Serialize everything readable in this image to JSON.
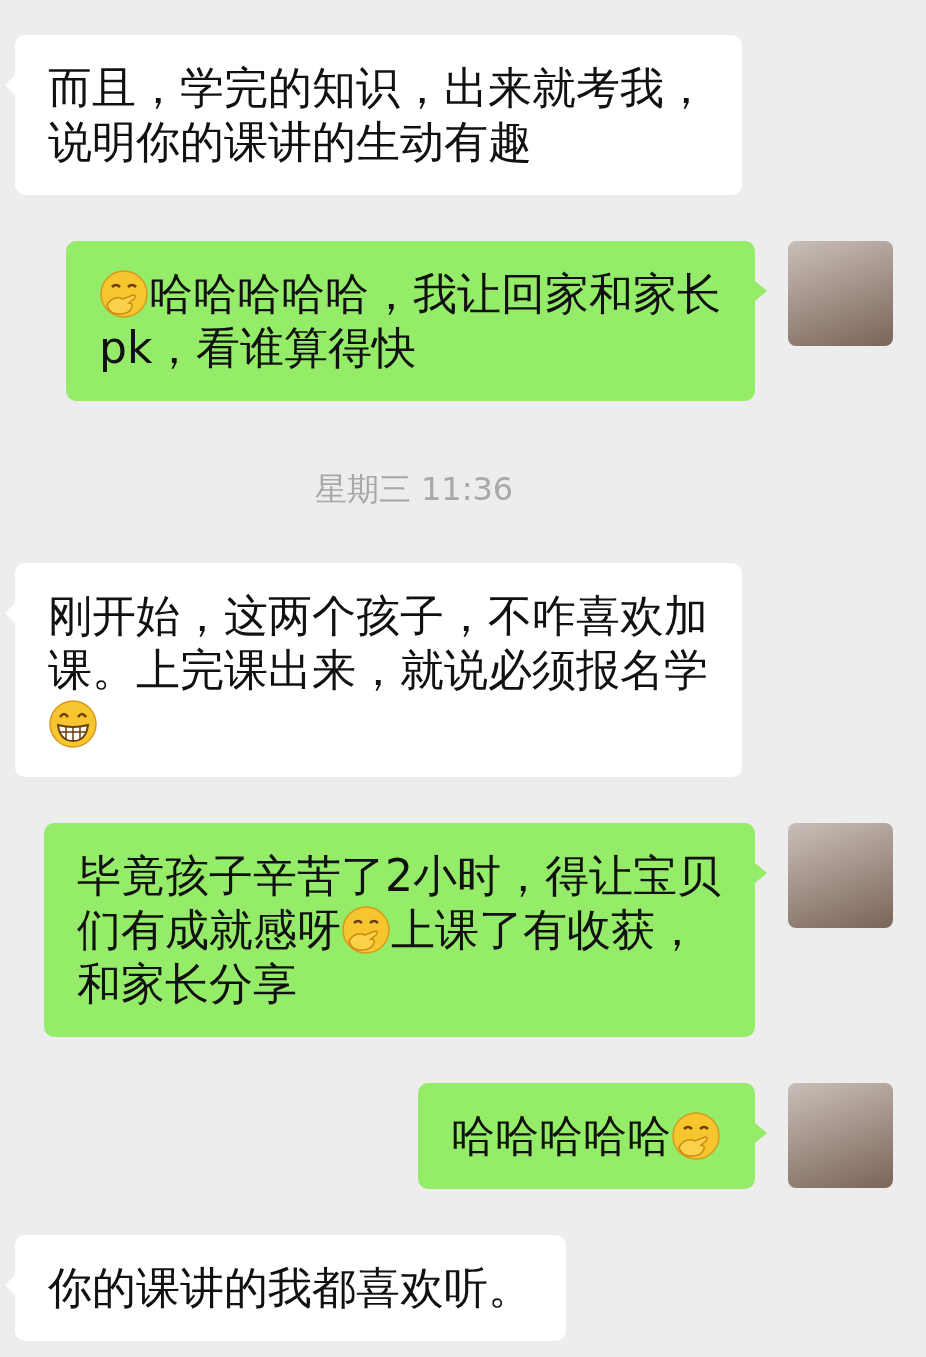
{
  "messages": [
    {
      "kind": "received",
      "lines": [
        {
          "segments": [
            {
              "kind": "text",
              "text": "而且，学完的知识，出来就考我，"
            }
          ]
        },
        {
          "segments": [
            {
              "kind": "text",
              "text": "说明你的课讲的生动有趣"
            }
          ]
        }
      ]
    },
    {
      "kind": "sent",
      "lines": [
        {
          "segments": [
            {
              "kind": "handmouth"
            },
            {
              "kind": "text",
              "text": "哈哈哈哈哈，我让回家和家长"
            }
          ]
        },
        {
          "segments": [
            {
              "kind": "text",
              "text": "pk，看谁算得快"
            }
          ]
        }
      ]
    },
    {
      "kind": "time",
      "text": "星期三 11:36"
    },
    {
      "kind": "received",
      "lines": [
        {
          "segments": [
            {
              "kind": "text",
              "text": "刚开始，这两个孩子，不咋喜欢加"
            }
          ]
        },
        {
          "segments": [
            {
              "kind": "text",
              "text": "课。上完课出来，就说必须报名学"
            }
          ]
        },
        {
          "segments": [
            {
              "kind": "grin"
            }
          ]
        }
      ]
    },
    {
      "kind": "sent",
      "lines": [
        {
          "segments": [
            {
              "kind": "text",
              "text": "毕竟孩子辛苦了2小时，得让宝贝"
            }
          ]
        },
        {
          "segments": [
            {
              "kind": "text",
              "text": "们有成就感呀"
            },
            {
              "kind": "handmouth"
            },
            {
              "kind": "text",
              "text": "上课了有收获，"
            }
          ]
        },
        {
          "segments": [
            {
              "kind": "text",
              "text": "和家长分享"
            }
          ]
        }
      ]
    },
    {
      "kind": "sent",
      "lines": [
        {
          "segments": [
            {
              "kind": "text",
              "text": "哈哈哈哈哈"
            },
            {
              "kind": "handmouth"
            }
          ]
        }
      ]
    },
    {
      "kind": "received",
      "lines": [
        {
          "segments": [
            {
              "kind": "text",
              "text": "你的课讲的我都喜欢听。"
            }
          ]
        }
      ]
    }
  ]
}
